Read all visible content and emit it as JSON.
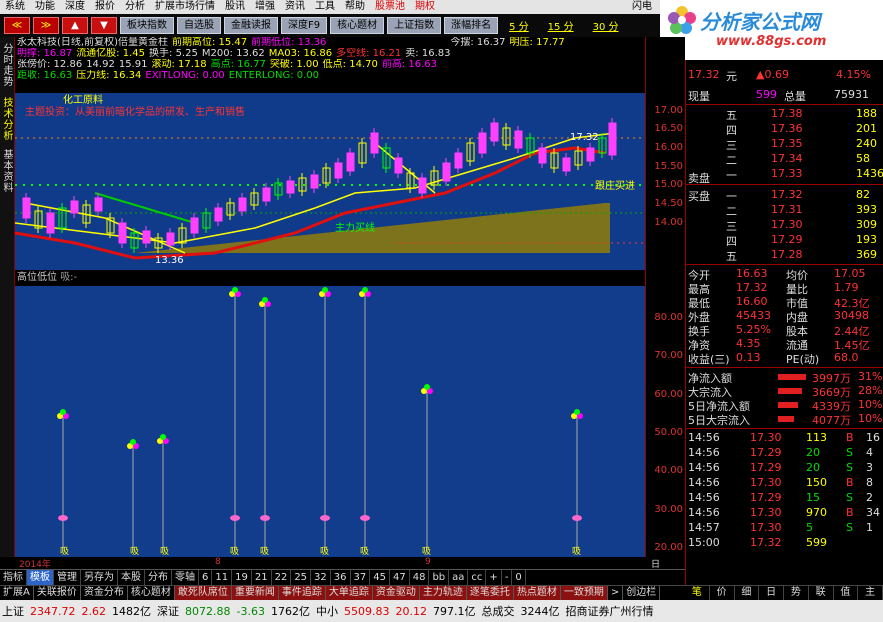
{
  "menu": [
    "系统",
    "功能",
    "深度",
    "报价",
    "分析",
    "扩展市场行情",
    "股讯",
    "增强",
    "资讯",
    "工具",
    "帮助",
    "股票池",
    "期权"
  ],
  "menu_right": "闪电",
  "toolbar": {
    "b1": "≪",
    "b2": "≫",
    "b3": "▲",
    "b4": "▼",
    "buttons": [
      "板块指数",
      "自选股",
      "金融读报",
      "深度F9",
      "核心题材",
      "上证指数",
      "涨幅排名"
    ],
    "links": [
      "5 分",
      "15 分",
      "30 分"
    ]
  },
  "logo": {
    "line1": "分析家公式网",
    "line2": "www.88gs.com"
  },
  "sidebar": [
    "分时走势",
    "技术分析",
    "基本资料"
  ],
  "kinfo": {
    "r1": [
      "永太科技(日线,前复权)倍量黄金柱",
      "前期高位: 15.47",
      "前期低位: 13.36",
      "今摆: 16.37",
      "明压: 17.77"
    ],
    "r2": [
      "明撑: 16.87",
      "流通亿股: 1.45",
      "换手: 5.25",
      "M200: 13.62",
      "MA03: 16.86",
      "多空线: 16.21",
      "卖: 16.83"
    ],
    "r3": [
      "张傍价: 12.86",
      "14.92",
      "15.91",
      "滚动: 17.18",
      "高点: 16.77",
      "突破: 1.00",
      "低点: 14.70",
      "前高: 16.63"
    ],
    "r4": [
      "距收: 16.63",
      "压力线: 16.34",
      "EXITLONG: 0.00",
      "ENTERLONG: 0.00"
    ]
  },
  "kchart": {
    "label1": "化工原料",
    "label2": "主题投资：从美丽前暗化学品的研发、生产和销售",
    "hi": "17.32",
    "lo": "13.36",
    "tag1": "跟庄买进",
    "tag2": "主力买线"
  },
  "yticks": [
    "17.00",
    "16.50",
    "16.00",
    "15.50",
    "15.00",
    "14.50",
    "14.00",
    "80.00",
    "70.00",
    "60.00",
    "50.00",
    "40.00",
    "30.00",
    "20.00",
    "10.00"
  ],
  "indicator": {
    "title": "高位低位",
    "sub": "吸:-",
    "marker": "吸"
  },
  "xaxis": {
    "year": "2014年",
    "m8": "8",
    "m9": "9",
    "rlabel": "日线"
  },
  "tabs": [
    "指标",
    "模板",
    "管理",
    "另存为",
    "本股",
    "分布",
    "零轴",
    "6",
    "11",
    "19",
    "21",
    "22",
    "25",
    "32",
    "36",
    "37",
    "45",
    "47",
    "48",
    "bb",
    "aa",
    "cc",
    "+",
    "-",
    "0"
  ],
  "tabs2": [
    "扩展A",
    "关联报价",
    "资金分布",
    "核心题材",
    "敢死队席位",
    "重要新闻",
    "事件追踪",
    "大单追踪",
    "资金驱动",
    "主力轨迹",
    "逐笔委托",
    "热点题材",
    "一致预期",
    ">",
    "创边栏"
  ],
  "status": {
    "sh_label": "上证",
    "sh": "2347.72",
    "sh_chg": "2.62",
    "sh_vol": "1482亿",
    "sz_label": "深证",
    "sz": "8072.88",
    "sz_chg": "-3.63",
    "sz_vol": "1762亿",
    "zx_label": "中小",
    "zx": "5509.83",
    "zx_chg": "20.12",
    "zx_vol": "797.1亿",
    "total_label": "总成交",
    "total": "3244亿",
    "broker": "招商证券广州行情"
  },
  "quote": {
    "name": "永太科技",
    "price": "17.32",
    "unit": "元",
    "chg": "▲0.69",
    "pct": "4.15%",
    "xianliang": "599",
    "zongliang": "75931",
    "asks": [
      [
        "五",
        "17.38",
        "188"
      ],
      [
        "四",
        "17.36",
        "201"
      ],
      [
        "三",
        "17.35",
        "240"
      ],
      [
        "二",
        "17.34",
        "58"
      ],
      [
        "一",
        "17.33",
        "1436"
      ]
    ],
    "bids": [
      [
        "一",
        "17.32",
        "82"
      ],
      [
        "二",
        "17.31",
        "393"
      ],
      [
        "三",
        "17.30",
        "309"
      ],
      [
        "四",
        "17.29",
        "193"
      ],
      [
        "五",
        "17.28",
        "369"
      ]
    ],
    "stats": [
      [
        "今开",
        "16.63",
        "均价",
        "17.05"
      ],
      [
        "最高",
        "17.32",
        "量比",
        "1.79"
      ],
      [
        "最低",
        "16.60",
        "市值",
        "42.3亿"
      ],
      [
        "外盘",
        "45433",
        "内盘",
        "30498"
      ],
      [
        "换手",
        "5.25%",
        "股本",
        "2.44亿"
      ],
      [
        "净资",
        "4.35",
        "流通",
        "1.45亿"
      ],
      [
        "收益(三)",
        "0.13",
        "PE(动)",
        "68.0"
      ]
    ],
    "flows": [
      [
        "净流入额",
        "3997万",
        "31%"
      ],
      [
        "大宗流入",
        "3669万",
        "28%"
      ],
      [
        "5日净流入额",
        "4339万",
        "10%"
      ],
      [
        "5日大宗流入",
        "4077万",
        "10%"
      ]
    ],
    "ticks": [
      [
        "14:56",
        "17.30",
        "113",
        "B",
        "16"
      ],
      [
        "14:56",
        "17.29",
        "20",
        "S",
        "4"
      ],
      [
        "14:56",
        "17.29",
        "20",
        "S",
        "3"
      ],
      [
        "14:56",
        "17.30",
        "150",
        "B",
        "8"
      ],
      [
        "14:56",
        "17.29",
        "15",
        "S",
        "2"
      ],
      [
        "14:56",
        "17.30",
        "970",
        "B",
        "34"
      ],
      [
        "14:57",
        "17.30",
        "5",
        "S",
        "1"
      ],
      [
        "15:00",
        "17.32",
        "599",
        "",
        ""
      ]
    ],
    "labels": {
      "xianliang": "现量",
      "zongliang": "总量",
      "maipan": "卖盘",
      "maipan2": "买盘"
    },
    "rtabs": [
      "笔",
      "价",
      "细",
      "日",
      "势",
      "联",
      "值",
      "主"
    ]
  }
}
